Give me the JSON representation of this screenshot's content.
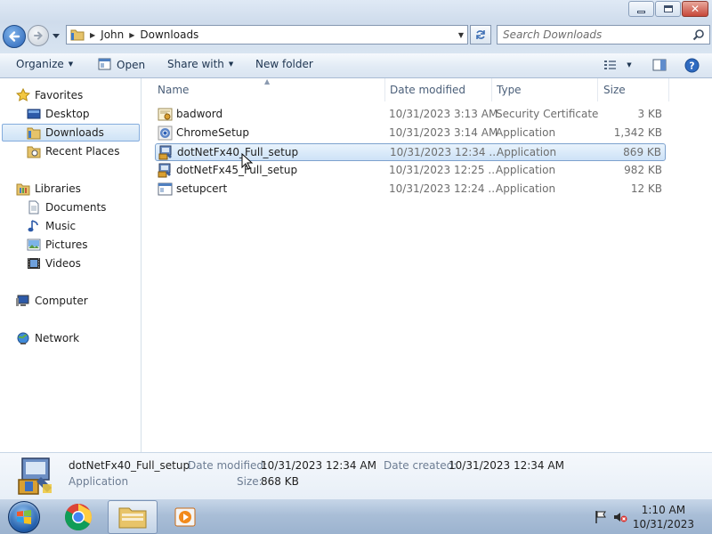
{
  "window": {
    "controls": {
      "minimize": "minimize",
      "maximize": "maximize",
      "close": "close"
    }
  },
  "address": {
    "crumbs": [
      "John",
      "Downloads"
    ]
  },
  "search": {
    "placeholder": "Search Downloads"
  },
  "toolbar": {
    "organize": "Organize",
    "open": "Open",
    "share_with": "Share with",
    "new_folder": "New folder"
  },
  "nav": {
    "favorites": "Favorites",
    "desktop": "Desktop",
    "downloads": "Downloads",
    "recent_places": "Recent Places",
    "libraries": "Libraries",
    "documents": "Documents",
    "music": "Music",
    "pictures": "Pictures",
    "videos": "Videos",
    "computer": "Computer",
    "network": "Network"
  },
  "columns": {
    "name": "Name",
    "date_modified": "Date modified",
    "type": "Type",
    "size": "Size"
  },
  "files": [
    {
      "name": "badword",
      "date": "10/31/2023 3:13 AM",
      "type": "Security Certificate",
      "size": "3 KB",
      "icon": "certificate-icon"
    },
    {
      "name": "ChromeSetup",
      "date": "10/31/2023 3:14 AM",
      "type": "Application",
      "size": "1,342 KB",
      "icon": "chrome-setup-icon"
    },
    {
      "name": "dotNetFx40_Full_setup",
      "date": "10/31/2023 12:34 ...",
      "type": "Application",
      "size": "869 KB",
      "icon": "installer-icon"
    },
    {
      "name": "dotNetFx45_Full_setup",
      "date": "10/31/2023 12:25 ...",
      "type": "Application",
      "size": "982 KB",
      "icon": "installer-icon"
    },
    {
      "name": "setupcert",
      "date": "10/31/2023 12:24 ...",
      "type": "Application",
      "size": "12 KB",
      "icon": "application-icon"
    }
  ],
  "details": {
    "name": "dotNetFx40_Full_setup",
    "type": "Application",
    "date_modified_label": "Date modified:",
    "date_modified": "10/31/2023 12:34 AM",
    "date_created_label": "Date created:",
    "date_created": "10/31/2023 12:34 AM",
    "size_label": "Size:",
    "size": "868 KB"
  },
  "taskbar": {
    "time": "1:10 AM",
    "date": "10/31/2023"
  },
  "colors": {
    "selection": "#cde2f7",
    "selection_border": "#7da2ce",
    "taskbar": "#a9bed7"
  }
}
